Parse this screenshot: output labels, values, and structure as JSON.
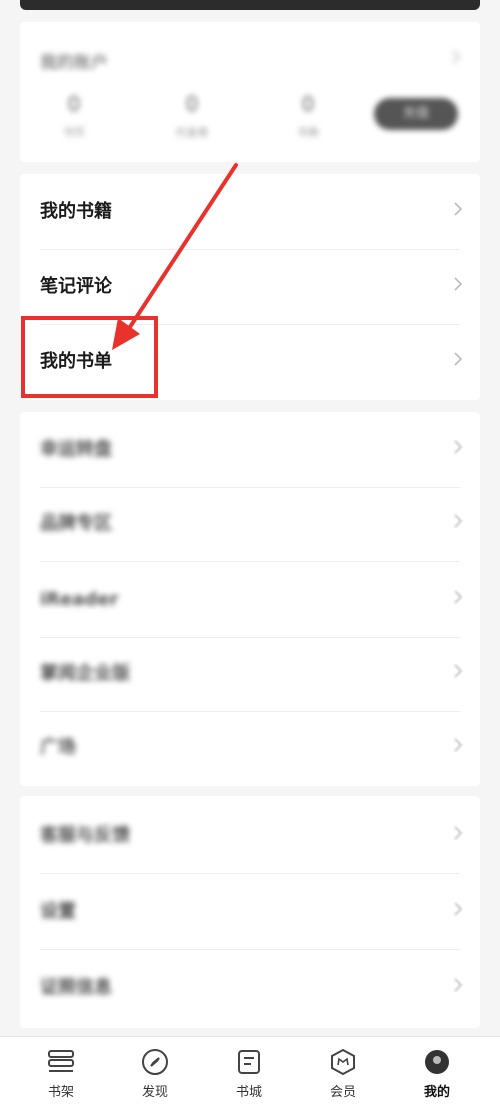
{
  "account": {
    "title": "我的账户",
    "stats": [
      {
        "value": "0",
        "label": "书币"
      },
      {
        "value": "0",
        "label": "代金券"
      },
      {
        "value": "0",
        "label": "书券"
      }
    ],
    "button_label": "充值"
  },
  "group1": [
    {
      "label": "我的书籍"
    },
    {
      "label": "笔记评论"
    },
    {
      "label": "我的书单"
    }
  ],
  "group2": [
    {
      "label": "幸运转盘"
    },
    {
      "label": "品牌专区"
    },
    {
      "label": "iReader"
    },
    {
      "label": "掌阅企业版"
    },
    {
      "label": "广场"
    }
  ],
  "group3": [
    {
      "label": "客服与反馈"
    },
    {
      "label": "设置"
    },
    {
      "label": "证照信息"
    }
  ],
  "nav": [
    {
      "label": "书架",
      "icon": "bookshelf-icon"
    },
    {
      "label": "发现",
      "icon": "compass-icon"
    },
    {
      "label": "书城",
      "icon": "bookstore-icon"
    },
    {
      "label": "会员",
      "icon": "vip-crown-icon"
    },
    {
      "label": "我的",
      "icon": "avatar-icon"
    }
  ],
  "colors": {
    "highlight": "#e8322b",
    "background": "#f5f5f5"
  }
}
